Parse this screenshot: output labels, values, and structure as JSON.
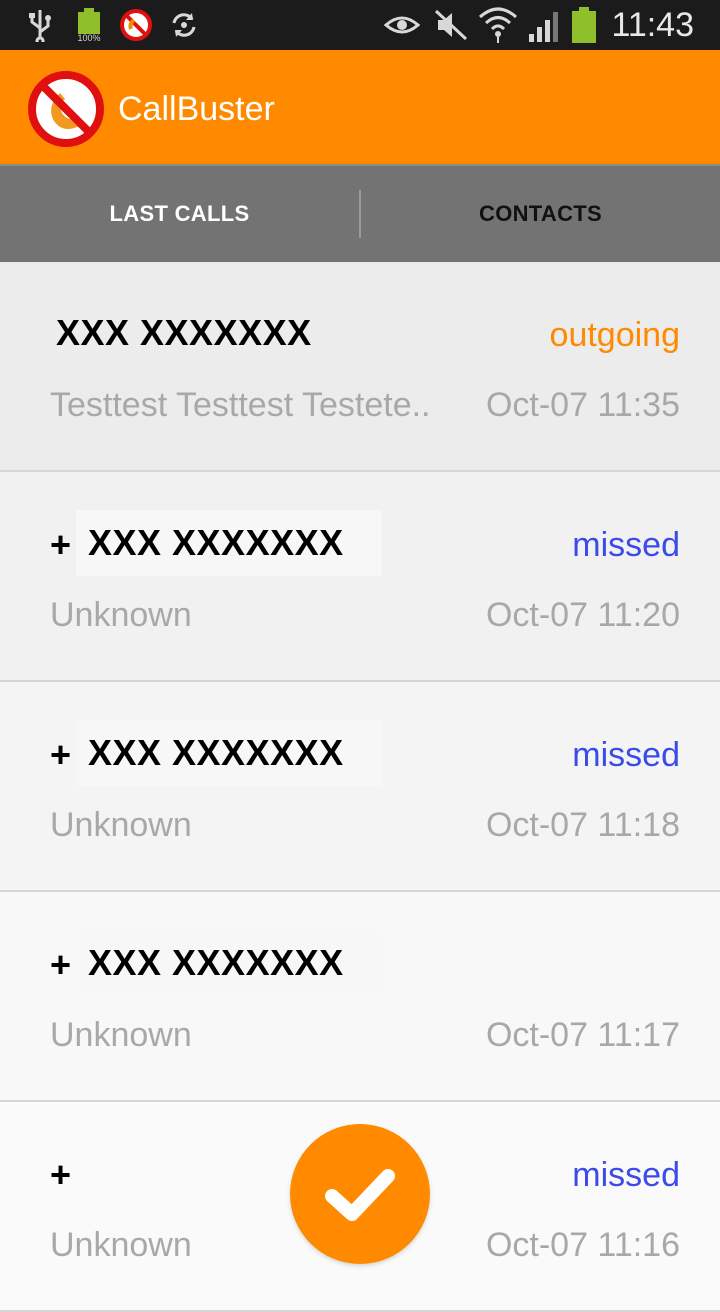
{
  "status_bar": {
    "time": "11:43",
    "battery_percent_label": "100%",
    "icons": [
      "usb-icon",
      "battery-icon",
      "callbuster-notification-icon",
      "sync-icon",
      "eye-icon",
      "mute-icon",
      "wifi-icon",
      "signal-icon",
      "battery-icon"
    ]
  },
  "app_bar": {
    "title": "CallBuster",
    "logo_icon": "blocked-phone-icon",
    "color": "#ff8a00"
  },
  "tabs": [
    {
      "label": "LAST CALLS",
      "selected": true
    },
    {
      "label": "CONTACTS",
      "selected": false
    }
  ],
  "calls": [
    {
      "prefix": "",
      "number": "XXX XXXXXXX",
      "type": "outgoing",
      "name": "Testtest Testtest Testete..",
      "time": "Oct-07 11:35"
    },
    {
      "prefix": "+",
      "number": "XXX XXXXXXX",
      "type": "missed",
      "name": "Unknown",
      "time": "Oct-07 11:20"
    },
    {
      "prefix": "+",
      "number": "XXX XXXXXXX",
      "type": "missed",
      "name": "Unknown",
      "time": "Oct-07 11:18"
    },
    {
      "prefix": "+",
      "number": "XXX XXXXXXX",
      "type": "",
      "name": "Unknown",
      "time": "Oct-07 11:17"
    },
    {
      "prefix": "+",
      "number": "",
      "type": "missed",
      "name": "Unknown",
      "time": "Oct-07 11:16"
    }
  ],
  "colors": {
    "outgoing": "#ff8a00",
    "missed": "#3a4bea",
    "secondary_text": "#a8a8a8"
  },
  "fab": {
    "icon": "checkmark-icon"
  }
}
